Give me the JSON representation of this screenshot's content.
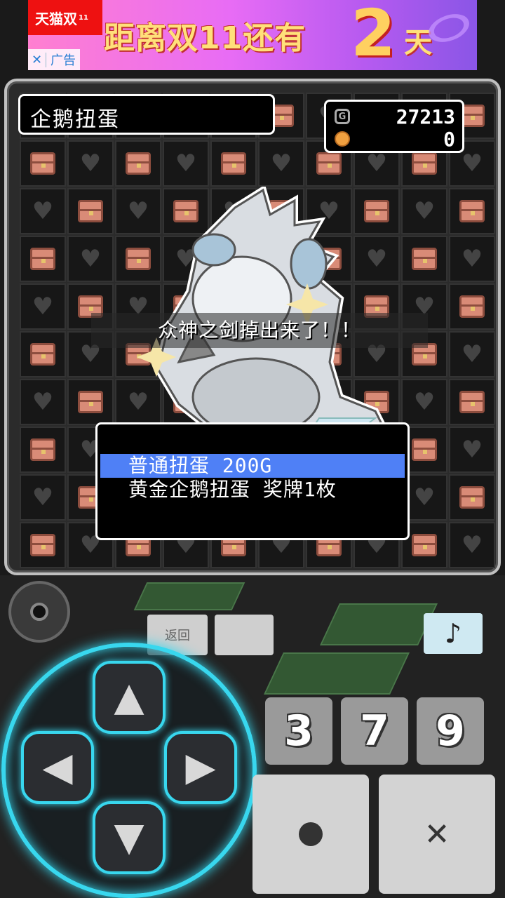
{
  "ad": {
    "brand": "天猫双",
    "brand_tag": "11",
    "headline": "距离双11还有",
    "days": "2",
    "days_unit": "天",
    "close": "✕",
    "label": "广告"
  },
  "game": {
    "title": "企鹅扭蛋",
    "currency": {
      "gold_icon": "G",
      "gold": "27213",
      "medals": "0"
    },
    "message": "众神之剑掉出来了！！",
    "menu": [
      {
        "label": "普通扭蛋 200G",
        "selected": true
      },
      {
        "label": "黄金企鹅扭蛋 奖牌1枚",
        "selected": false
      }
    ]
  },
  "controls": {
    "back_label": "返回",
    "music_icon": "♪",
    "num_buttons": [
      "3",
      "7",
      "9"
    ],
    "confirm_icon": "●",
    "cancel_icon": "✕",
    "dpad": {
      "up": "▲",
      "down": "▼",
      "left": "◀",
      "right": "▶"
    }
  },
  "colors": {
    "selection": "#4f80f6",
    "dpad_glow": "#38d7ee",
    "chest": "#d98b77"
  }
}
